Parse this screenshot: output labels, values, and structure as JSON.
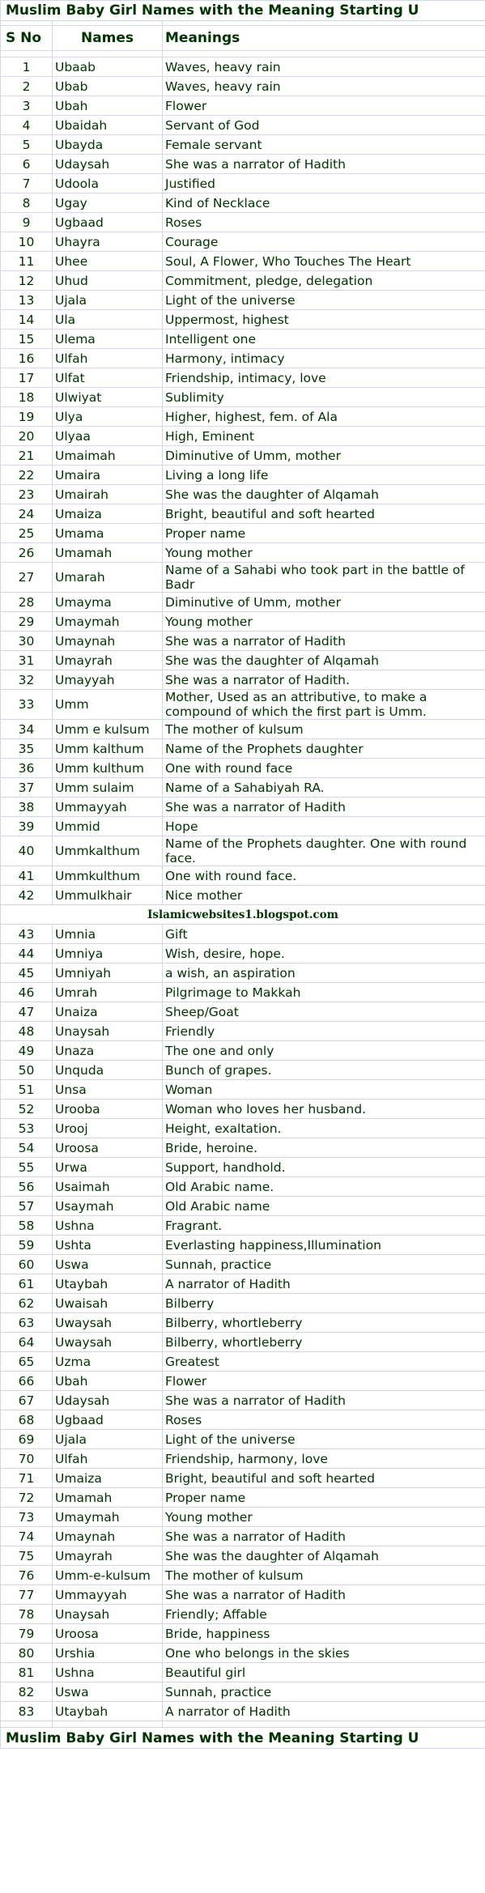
{
  "title": "Muslim Baby Girl Names with the Meaning Starting U",
  "headers": {
    "sno": "S No",
    "names": "Names",
    "meanings": "Meanings"
  },
  "watermark": "Islamicwebsites1.blogspot.com",
  "footer_title": "Muslim Baby Girl Names with the Meaning Starting U",
  "colors": {
    "text": "#003300",
    "grid": "#d0d7e5",
    "background": "#ffffff"
  },
  "rows_part1": [
    {
      "sno": "1",
      "name": "Ubaab",
      "meaning": "Waves, heavy rain"
    },
    {
      "sno": "2",
      "name": "Ubab",
      "meaning": "Waves, heavy rain"
    },
    {
      "sno": "3",
      "name": "Ubah",
      "meaning": "Flower"
    },
    {
      "sno": "4",
      "name": "Ubaidah",
      "meaning": "Servant of God"
    },
    {
      "sno": "5",
      "name": "Ubayda",
      "meaning": "Female servant"
    },
    {
      "sno": "6",
      "name": "Udaysah",
      "meaning": "She was a narrator of Hadith"
    },
    {
      "sno": "7",
      "name": "Udoola",
      "meaning": "Justified"
    },
    {
      "sno": "8",
      "name": "Ugay",
      "meaning": "Kind of Necklace"
    },
    {
      "sno": "9",
      "name": "Ugbaad",
      "meaning": "Roses"
    },
    {
      "sno": "10",
      "name": "Uhayra",
      "meaning": "Courage"
    },
    {
      "sno": "11",
      "name": "Uhee",
      "meaning": "Soul, A Flower, Who Touches The Heart"
    },
    {
      "sno": "12",
      "name": "Uhud",
      "meaning": "Commitment, pledge, delegation"
    },
    {
      "sno": "13",
      "name": "Ujala",
      "meaning": "Light of the universe"
    },
    {
      "sno": "14",
      "name": "Ula",
      "meaning": "Uppermost, highest"
    },
    {
      "sno": "15",
      "name": "Ulema",
      "meaning": "Intelligent one"
    },
    {
      "sno": "16",
      "name": "Ulfah",
      "meaning": "Harmony, intimacy"
    },
    {
      "sno": "17",
      "name": "Ulfat",
      "meaning": "Friendship, intimacy, love"
    },
    {
      "sno": "18",
      "name": "Ulwiyat",
      "meaning": "Sublimity"
    },
    {
      "sno": "19",
      "name": "Ulya",
      "meaning": "Higher, highest, fem. of Ala"
    },
    {
      "sno": "20",
      "name": "Ulyaa",
      "meaning": "High, Eminent"
    },
    {
      "sno": "21",
      "name": "Umaimah",
      "meaning": "Diminutive of Umm, mother"
    },
    {
      "sno": "22",
      "name": "Umaira",
      "meaning": "Living a long life"
    },
    {
      "sno": "23",
      "name": "Umairah",
      "meaning": "She was the daughter of Alqamah"
    },
    {
      "sno": "24",
      "name": "Umaiza",
      "meaning": "Bright, beautiful and soft hearted"
    },
    {
      "sno": "25",
      "name": "Umama",
      "meaning": "Proper name"
    },
    {
      "sno": "26",
      "name": "Umamah",
      "meaning": "Young mother"
    },
    {
      "sno": "27",
      "name": "Umarah",
      "meaning": "Name of a Sahabi who took part in the battle of Badr"
    },
    {
      "sno": "28",
      "name": "Umayma",
      "meaning": "Diminutive of Umm, mother"
    },
    {
      "sno": "29",
      "name": "Umaymah",
      "meaning": "Young mother"
    },
    {
      "sno": "30",
      "name": "Umaynah",
      "meaning": "She was a narrator of Hadith"
    },
    {
      "sno": "31",
      "name": "Umayrah",
      "meaning": "She was the daughter of Alqamah"
    },
    {
      "sno": "32",
      "name": "Umayyah",
      "meaning": "She was a narrator of Hadith."
    },
    {
      "sno": "33",
      "name": "Umm",
      "meaning": "Mother, Used as an attributive, to make a compound of which the first part is Umm."
    },
    {
      "sno": "34",
      "name": "Umm e kulsum",
      "meaning": "The mother of kulsum"
    },
    {
      "sno": "35",
      "name": "Umm kalthum",
      "meaning": "Name of the Prophets daughter"
    },
    {
      "sno": "36",
      "name": "Umm kulthum",
      "meaning": "One with round face"
    },
    {
      "sno": "37",
      "name": "Umm sulaim",
      "meaning": "Name of a Sahabiyah RA."
    },
    {
      "sno": "38",
      "name": "Ummayyah",
      "meaning": "She was a narrator of Hadith"
    },
    {
      "sno": "39",
      "name": "Ummid",
      "meaning": "Hope"
    },
    {
      "sno": "40",
      "name": "Ummkalthum",
      "meaning": "Name of the Prophets daughter. One with round face."
    },
    {
      "sno": "41",
      "name": "Ummkulthum",
      "meaning": "One with round face."
    },
    {
      "sno": "42",
      "name": "Ummulkhair",
      "meaning": "Nice mother"
    }
  ],
  "rows_part2": [
    {
      "sno": "43",
      "name": "Umnia",
      "meaning": "Gift"
    },
    {
      "sno": "44",
      "name": "Umniya",
      "meaning": "Wish, desire, hope."
    },
    {
      "sno": "45",
      "name": "Umniyah",
      "meaning": "a wish, an aspiration"
    },
    {
      "sno": "46",
      "name": "Umrah",
      "meaning": "Pilgrimage to Makkah"
    },
    {
      "sno": "47",
      "name": "Unaiza",
      "meaning": "Sheep/Goat"
    },
    {
      "sno": "48",
      "name": "Unaysah",
      "meaning": "Friendly"
    },
    {
      "sno": "49",
      "name": "Unaza",
      "meaning": "The one and only"
    },
    {
      "sno": "50",
      "name": "Unquda",
      "meaning": "Bunch of grapes."
    },
    {
      "sno": "51",
      "name": "Unsa",
      "meaning": "Woman"
    },
    {
      "sno": "52",
      "name": "Urooba",
      "meaning": "Woman who loves her husband."
    },
    {
      "sno": "53",
      "name": "Urooj",
      "meaning": "Height, exaltation."
    },
    {
      "sno": "54",
      "name": "Uroosa",
      "meaning": "Bride, heroine."
    },
    {
      "sno": "55",
      "name": "Urwa",
      "meaning": "Support, handhold."
    },
    {
      "sno": "56",
      "name": "Usaimah",
      "meaning": "Old Arabic name."
    },
    {
      "sno": "57",
      "name": "Usaymah",
      "meaning": "Old Arabic name"
    },
    {
      "sno": "58",
      "name": "Ushna",
      "meaning": "Fragrant."
    },
    {
      "sno": "59",
      "name": "Ushta",
      "meaning": "Everlasting happiness,Illumination"
    },
    {
      "sno": "60",
      "name": "Uswa",
      "meaning": "Sunnah, practice"
    },
    {
      "sno": "61",
      "name": "Utaybah",
      "meaning": "A narrator of Hadith"
    },
    {
      "sno": "62",
      "name": "Uwaisah",
      "meaning": "Bilberry"
    },
    {
      "sno": "63",
      "name": "Uwaysah",
      "meaning": "Bilberry, whortleberry"
    },
    {
      "sno": "64",
      "name": "Uwaysah",
      "meaning": "Bilberry, whortleberry"
    },
    {
      "sno": "65",
      "name": "Uzma",
      "meaning": "Greatest"
    },
    {
      "sno": "66",
      "name": "Ubah",
      "meaning": "Flower"
    },
    {
      "sno": "67",
      "name": "Udaysah",
      "meaning": "She was a narrator of Hadith"
    },
    {
      "sno": "68",
      "name": "Ugbaad",
      "meaning": "Roses"
    },
    {
      "sno": "69",
      "name": "Ujala",
      "meaning": "Light of the universe"
    },
    {
      "sno": "70",
      "name": "Ulfah",
      "meaning": "Friendship, harmony, love"
    },
    {
      "sno": "71",
      "name": "Umaiza",
      "meaning": "Bright, beautiful and soft hearted"
    },
    {
      "sno": "72",
      "name": "Umamah",
      "meaning": "Proper name"
    },
    {
      "sno": "73",
      "name": "Umaymah",
      "meaning": "Young mother"
    },
    {
      "sno": "74",
      "name": "Umaynah",
      "meaning": "She was a narrator of Hadith"
    },
    {
      "sno": "75",
      "name": "Umayrah",
      "meaning": "She was the daughter of Alqamah"
    },
    {
      "sno": "76",
      "name": "Umm-e-kulsum",
      "meaning": "The mother of kulsum"
    },
    {
      "sno": "77",
      "name": "Ummayyah",
      "meaning": "She was a narrator of Hadith"
    },
    {
      "sno": "78",
      "name": "Unaysah",
      "meaning": "Friendly; Affable"
    },
    {
      "sno": "79",
      "name": "Uroosa",
      "meaning": "Bride, happiness"
    },
    {
      "sno": "80",
      "name": "Urshia",
      "meaning": "One who belongs in the skies"
    },
    {
      "sno": "81",
      "name": "Ushna",
      "meaning": "Beautiful girl"
    },
    {
      "sno": "82",
      "name": "Uswa",
      "meaning": "Sunnah, practice"
    },
    {
      "sno": "83",
      "name": "Utaybah",
      "meaning": "A narrator of Hadith"
    }
  ]
}
